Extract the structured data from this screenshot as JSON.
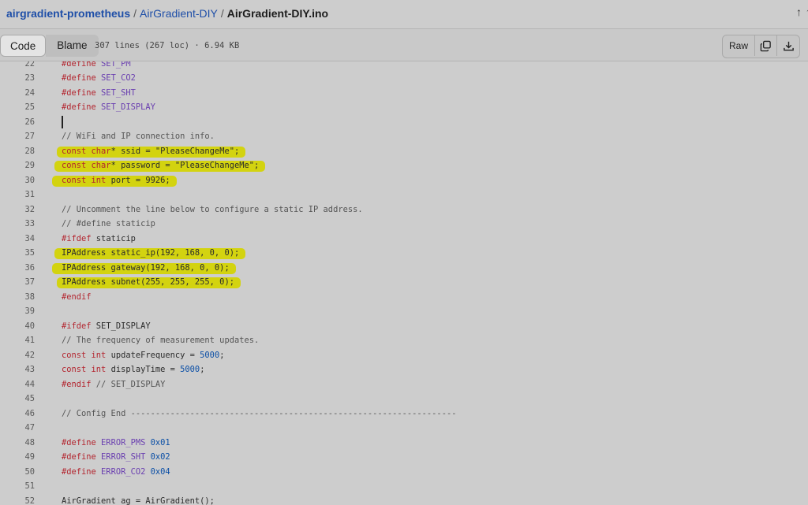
{
  "breadcrumb": {
    "repo": "airgradient-prometheus",
    "folder": "AirGradient-DIY",
    "file": "AirGradient-DIY.ino",
    "separator": "/"
  },
  "header_icons": [
    "arrow-up-icon",
    "cut-off-icon"
  ],
  "toolbar": {
    "code_tab": "Code",
    "blame_tab": "Blame",
    "file_info": "307 lines (267 loc) · 6.94 KB",
    "raw_label": "Raw",
    "copy_icon": "copy-icon",
    "download_icon": "download-icon"
  },
  "highlight_color": "#d4d400",
  "code_lines": [
    {
      "n": "22",
      "tokens": [
        {
          "t": "#define",
          "c": "kw"
        },
        {
          "t": " SET_PM",
          "c": "mac"
        }
      ]
    },
    {
      "n": "23",
      "tokens": [
        {
          "t": "#define",
          "c": "kw"
        },
        {
          "t": " SET_CO2",
          "c": "mac"
        }
      ]
    },
    {
      "n": "24",
      "tokens": [
        {
          "t": "#define",
          "c": "kw"
        },
        {
          "t": " SET_SHT",
          "c": "mac"
        }
      ]
    },
    {
      "n": "25",
      "tokens": [
        {
          "t": "#define",
          "c": "kw"
        },
        {
          "t": " SET_DISPLAY",
          "c": "mac"
        }
      ]
    },
    {
      "n": "26",
      "caret": true,
      "tokens": []
    },
    {
      "n": "27",
      "tokens": [
        {
          "t": "// WiFi and IP connection info.",
          "c": "cmt"
        }
      ]
    },
    {
      "n": "28",
      "hl": true,
      "tokens": [
        {
          "t": "const char",
          "c": "kw"
        },
        {
          "t": "* ssid = \"PleaseChangeMe\";",
          "c": ""
        }
      ]
    },
    {
      "n": "29",
      "hl": true,
      "tokens": [
        {
          "t": "const char",
          "c": "kw"
        },
        {
          "t": "* password = \"PleaseChangeMe\";",
          "c": ""
        }
      ]
    },
    {
      "n": "30",
      "hl": true,
      "tokens": [
        {
          "t": "const int",
          "c": "kw"
        },
        {
          "t": " port = 9926;",
          "c": ""
        }
      ]
    },
    {
      "n": "31",
      "tokens": []
    },
    {
      "n": "32",
      "tokens": [
        {
          "t": "// Uncomment the line below to configure a static IP address.",
          "c": "cmt"
        }
      ]
    },
    {
      "n": "33",
      "tokens": [
        {
          "t": "// #define staticip",
          "c": "cmt"
        }
      ]
    },
    {
      "n": "34",
      "tokens": [
        {
          "t": "#ifdef",
          "c": "kw"
        },
        {
          "t": " staticip",
          "c": ""
        }
      ]
    },
    {
      "n": "35",
      "hl": true,
      "tokens": [
        {
          "t": "IPAddress static_ip(192, 168, 0, 0);",
          "c": ""
        }
      ]
    },
    {
      "n": "36",
      "hl": true,
      "tokens": [
        {
          "t": "IPAddress gateway(192, 168, 0, 0);",
          "c": ""
        }
      ]
    },
    {
      "n": "37",
      "hl": true,
      "tokens": [
        {
          "t": "IPAddress subnet(255, 255, 255, 0);",
          "c": ""
        }
      ]
    },
    {
      "n": "38",
      "tokens": [
        {
          "t": "#endif",
          "c": "kw"
        }
      ]
    },
    {
      "n": "39",
      "tokens": []
    },
    {
      "n": "40",
      "tokens": [
        {
          "t": "#ifdef",
          "c": "kw"
        },
        {
          "t": " SET_DISPLAY",
          "c": ""
        }
      ]
    },
    {
      "n": "41",
      "tokens": [
        {
          "t": "// The frequency of measurement updates.",
          "c": "cmt"
        }
      ]
    },
    {
      "n": "42",
      "tokens": [
        {
          "t": "const int",
          "c": "kw"
        },
        {
          "t": " updateFrequency = ",
          "c": ""
        },
        {
          "t": "5000",
          "c": "num"
        },
        {
          "t": ";",
          "c": ""
        }
      ]
    },
    {
      "n": "43",
      "tokens": [
        {
          "t": "const int",
          "c": "kw"
        },
        {
          "t": " displayTime = ",
          "c": ""
        },
        {
          "t": "5000",
          "c": "num"
        },
        {
          "t": ";",
          "c": ""
        }
      ]
    },
    {
      "n": "44",
      "tokens": [
        {
          "t": "#endif",
          "c": "kw"
        },
        {
          "t": " // SET_DISPLAY",
          "c": "cmt"
        }
      ]
    },
    {
      "n": "45",
      "tokens": []
    },
    {
      "n": "46",
      "tokens": [
        {
          "t": "// Config End ------------------------------------------------------------------",
          "c": "cmt"
        }
      ]
    },
    {
      "n": "47",
      "tokens": []
    },
    {
      "n": "48",
      "tokens": [
        {
          "t": "#define",
          "c": "kw"
        },
        {
          "t": " ERROR_PMS",
          "c": "mac"
        },
        {
          "t": " 0x01",
          "c": "num"
        }
      ]
    },
    {
      "n": "49",
      "tokens": [
        {
          "t": "#define",
          "c": "kw"
        },
        {
          "t": " ERROR_SHT",
          "c": "mac"
        },
        {
          "t": " 0x02",
          "c": "num"
        }
      ]
    },
    {
      "n": "50",
      "tokens": [
        {
          "t": "#define",
          "c": "kw"
        },
        {
          "t": " ERROR_CO2",
          "c": "mac"
        },
        {
          "t": " 0x04",
          "c": "num"
        }
      ]
    },
    {
      "n": "51",
      "tokens": []
    },
    {
      "n": "52",
      "tokens": [
        {
          "t": "AirGradient ag = AirGradient();",
          "c": ""
        }
      ]
    }
  ]
}
